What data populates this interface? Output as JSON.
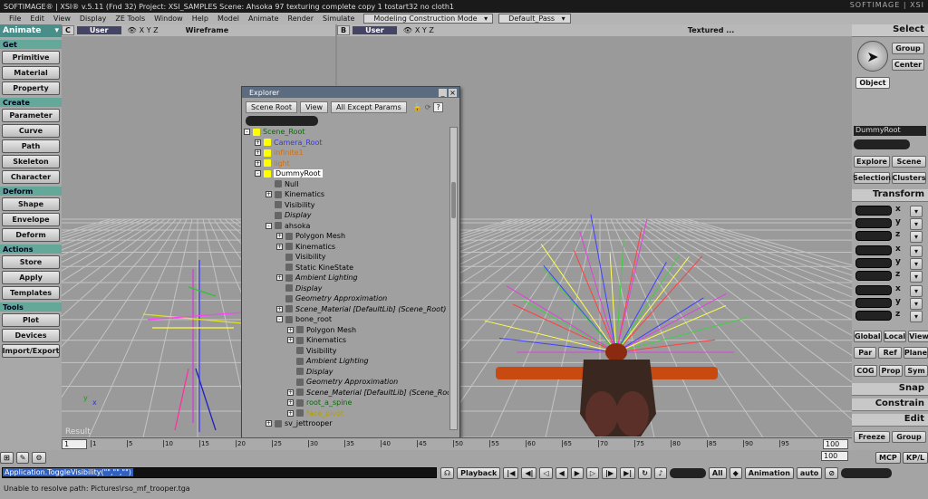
{
  "window": {
    "title": "SOFTIMAGE® | XSI® v.5.11 (Fnd 32) Project: XSI_SAMPLES     Scene: Ahsoka 97 texturing complete copy 1 tostart32 no cloth1",
    "brand": "SOFTIMAGE | XSI"
  },
  "menu": {
    "items": [
      "File",
      "Edit",
      "View",
      "Display",
      "ZE Tools",
      "Window",
      "Help",
      "Model",
      "Animate",
      "Render",
      "Simulate"
    ],
    "mode": "Modeling Construction Mode",
    "pass": "Default_Pass"
  },
  "left": {
    "mode": "Animate",
    "sections": [
      {
        "name": "Get",
        "buttons": [
          "Primitive",
          "Material",
          "Property"
        ]
      },
      {
        "name": "Create",
        "buttons": [
          "Parameter",
          "Curve",
          "Path",
          "Skeleton",
          "Character"
        ]
      },
      {
        "name": "Deform",
        "buttons": [
          "Shape",
          "Envelope",
          "Deform"
        ]
      },
      {
        "name": "Actions",
        "buttons": [
          "Store",
          "Apply",
          "Templates"
        ]
      },
      {
        "name": "Tools",
        "buttons": [
          "Plot",
          "Devices",
          "Import/Export"
        ]
      }
    ]
  },
  "viewports": {
    "left": {
      "letter": "C",
      "camera": "User",
      "axes": "X Y Z",
      "shading": "Wireframe"
    },
    "right": {
      "letter": "B",
      "camera": "User",
      "axes": "X Y Z",
      "shading": "Textured ..."
    }
  },
  "explorer": {
    "title": "Explorer",
    "scope": "Scene Root",
    "view": "View",
    "filter": "All Except Params",
    "tree": [
      {
        "d": 0,
        "t": "Scene_Root",
        "c": "#0a6a0a",
        "ex": "-"
      },
      {
        "d": 1,
        "t": "Camera_Root",
        "c": "#3a3ad0",
        "ex": "+"
      },
      {
        "d": 1,
        "t": "infinite1",
        "c": "#d07010",
        "ex": "+"
      },
      {
        "d": 1,
        "t": "light",
        "c": "#d07010",
        "ex": "+"
      },
      {
        "d": 1,
        "t": "DummyRoot",
        "c": "#000",
        "ex": "-",
        "sel": true
      },
      {
        "d": 2,
        "t": "Null",
        "c": "#000",
        "ex": ""
      },
      {
        "d": 2,
        "t": "Kinematics",
        "c": "#000",
        "ex": "+"
      },
      {
        "d": 2,
        "t": "Visibility",
        "c": "#000",
        "ex": ""
      },
      {
        "d": 2,
        "t": "Display",
        "c": "#000",
        "ex": "",
        "i": true
      },
      {
        "d": 2,
        "t": "ahsoka",
        "c": "#000",
        "ex": "-"
      },
      {
        "d": 3,
        "t": "Polygon Mesh",
        "c": "#000",
        "ex": "+"
      },
      {
        "d": 3,
        "t": "Kinematics",
        "c": "#000",
        "ex": "+"
      },
      {
        "d": 3,
        "t": "Visibility",
        "c": "#000",
        "ex": ""
      },
      {
        "d": 3,
        "t": "Static KineState",
        "c": "#000",
        "ex": ""
      },
      {
        "d": 3,
        "t": "Ambient Lighting",
        "c": "#000",
        "ex": "+",
        "i": true
      },
      {
        "d": 3,
        "t": "Display",
        "c": "#000",
        "ex": "",
        "i": true
      },
      {
        "d": 3,
        "t": "Geometry Approximation",
        "c": "#000",
        "ex": "",
        "i": true
      },
      {
        "d": 3,
        "t": "Scene_Material [DefaultLib] (Scene_Root)",
        "c": "#000",
        "ex": "+",
        "i": true
      },
      {
        "d": 3,
        "t": "bone_root",
        "c": "#000",
        "ex": "-"
      },
      {
        "d": 4,
        "t": "Polygon Mesh",
        "c": "#000",
        "ex": "+"
      },
      {
        "d": 4,
        "t": "Kinematics",
        "c": "#000",
        "ex": "+"
      },
      {
        "d": 4,
        "t": "Visibility",
        "c": "#000",
        "ex": ""
      },
      {
        "d": 4,
        "t": "Ambient Lighting",
        "c": "#000",
        "ex": "",
        "i": true
      },
      {
        "d": 4,
        "t": "Display",
        "c": "#000",
        "ex": "",
        "i": true
      },
      {
        "d": 4,
        "t": "Geometry Approximation",
        "c": "#000",
        "ex": "",
        "i": true
      },
      {
        "d": 4,
        "t": "Scene_Material [DefaultLib] (Scene_Roo",
        "c": "#000",
        "ex": "+",
        "i": true
      },
      {
        "d": 4,
        "t": "root_a_spine",
        "c": "#0a6a0a",
        "ex": "+"
      },
      {
        "d": 4,
        "t": "face_pivot",
        "c": "#b0a000",
        "ex": "+"
      },
      {
        "d": 2,
        "t": "sv_jettrooper",
        "c": "#000",
        "ex": "+"
      }
    ]
  },
  "right": {
    "header": "Select",
    "group": "Group",
    "center": "Center",
    "object": "Object",
    "name": "DummyRoot",
    "explore": "Explore",
    "scene": "Scene",
    "selection": "Selection",
    "clusters": "Clusters",
    "transform": "Transform",
    "xyz": [
      "x",
      "y",
      "z"
    ],
    "gl": [
      "Global",
      "Local",
      "View"
    ],
    "pr": [
      "Par",
      "Ref",
      "Plane"
    ],
    "cp": [
      "COG",
      "Prop",
      "Sym"
    ],
    "snap": "Snap",
    "constrain": "Constrain",
    "edit": "Edit",
    "freeze": "Freeze",
    "fgroup": "Group",
    "mcp": "MCP",
    "kpl": "KP/L"
  },
  "timeline": {
    "start": "1",
    "end": "100",
    "ticks": [
      "1",
      "5",
      "10",
      "15",
      "20",
      "25",
      "30",
      "35",
      "40",
      "45",
      "50",
      "55",
      "60",
      "65",
      "70",
      "75",
      "80",
      "85",
      "90",
      "95"
    ],
    "result": "Result"
  },
  "bottom": {
    "command": "Application.ToggleVisibility(\"\",\"\",\"\")",
    "status": "Unable to resolve path: Pictures\\rso_mf_trooper.tga",
    "playback": "Playback",
    "all": "All",
    "animation": "Animation",
    "auto": "auto",
    "start": "1",
    "end": "100"
  }
}
